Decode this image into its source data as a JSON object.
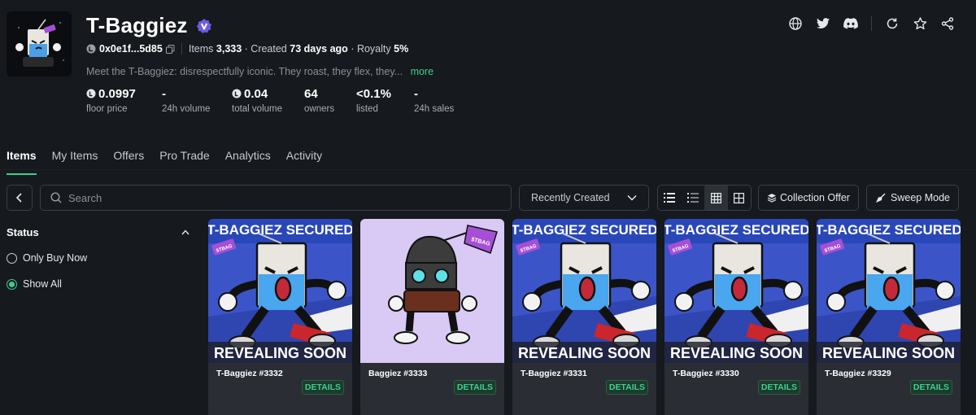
{
  "collection": {
    "name": "T-Baggiez",
    "address": "0x0e1f...5d85",
    "items_label": "Items",
    "items_count": "3,333",
    "created_label": "· Created",
    "created_value": "73 days ago",
    "royalty_label": "· Royalty",
    "royalty_value": "5%",
    "description": "Meet the T-Baggiez: disrespectfully iconic. They roast, they flex, they...",
    "more_label": "more"
  },
  "stats": [
    {
      "value": "0.0997",
      "label": "floor price",
      "icon": "coin-icon"
    },
    {
      "value": "-",
      "label": "24h volume"
    },
    {
      "value": "0.04",
      "label": "total volume",
      "icon": "coin-icon"
    },
    {
      "value": "64",
      "label": "owners"
    },
    {
      "value": "<0.1%",
      "label": "listed"
    },
    {
      "value": "-",
      "label": "24h sales"
    }
  ],
  "header_icons": [
    "globe-icon",
    "twitter-icon",
    "discord-icon",
    "refresh-icon",
    "star-icon",
    "share-icon"
  ],
  "tabs": [
    {
      "label": "Items",
      "active": true
    },
    {
      "label": "My Items"
    },
    {
      "label": "Offers"
    },
    {
      "label": "Pro Trade"
    },
    {
      "label": "Analytics"
    },
    {
      "label": "Activity"
    }
  ],
  "toolbar": {
    "search_placeholder": "Search",
    "sort_label": "Recently Created",
    "collection_offer_label": "Collection Offer",
    "sweep_label": "Sweep Mode",
    "active_view": "grid-view"
  },
  "filters": {
    "status_title": "Status",
    "options": [
      {
        "label": "Only Buy Now",
        "selected": false
      },
      {
        "label": "Show All",
        "selected": true
      }
    ]
  },
  "items": [
    {
      "name": "T-Baggiez #3332",
      "image": "unrevealed",
      "banner_top": "T-BAGGIEZ SECURED",
      "banner_bottom": "REVEALING SOON",
      "tag": "$TBAG",
      "details_label": "DETAILS"
    },
    {
      "name": "Baggiez #3333",
      "image": "revealed",
      "tag": "$TBAG",
      "details_label": "DETAILS"
    },
    {
      "name": "T-Baggiez #3331",
      "image": "unrevealed",
      "banner_top": "T-BAGGIEZ SECURED",
      "banner_bottom": "REVEALING SOON",
      "tag": "$TBAG",
      "details_label": "DETAILS"
    },
    {
      "name": "T-Baggiez #3330",
      "image": "unrevealed",
      "banner_top": "T-BAGGIEZ SECURED",
      "banner_bottom": "REVEALING SOON",
      "tag": "$TBAG",
      "details_label": "DETAILS"
    },
    {
      "name": "T-Baggiez #3329",
      "image": "unrevealed",
      "banner_top": "T-BAGGIEZ SECURED",
      "banner_bottom": "REVEALING SOON",
      "tag": "$TBAG",
      "details_label": "DETAILS"
    }
  ],
  "colors": {
    "background": "#16191d",
    "accent_green": "#3ecf8e",
    "verified_purple": "#6d5ce0",
    "card_blue": "#3b55c8",
    "card_lavender": "#d8c9f5",
    "tag_purple": "#a64fd6"
  }
}
